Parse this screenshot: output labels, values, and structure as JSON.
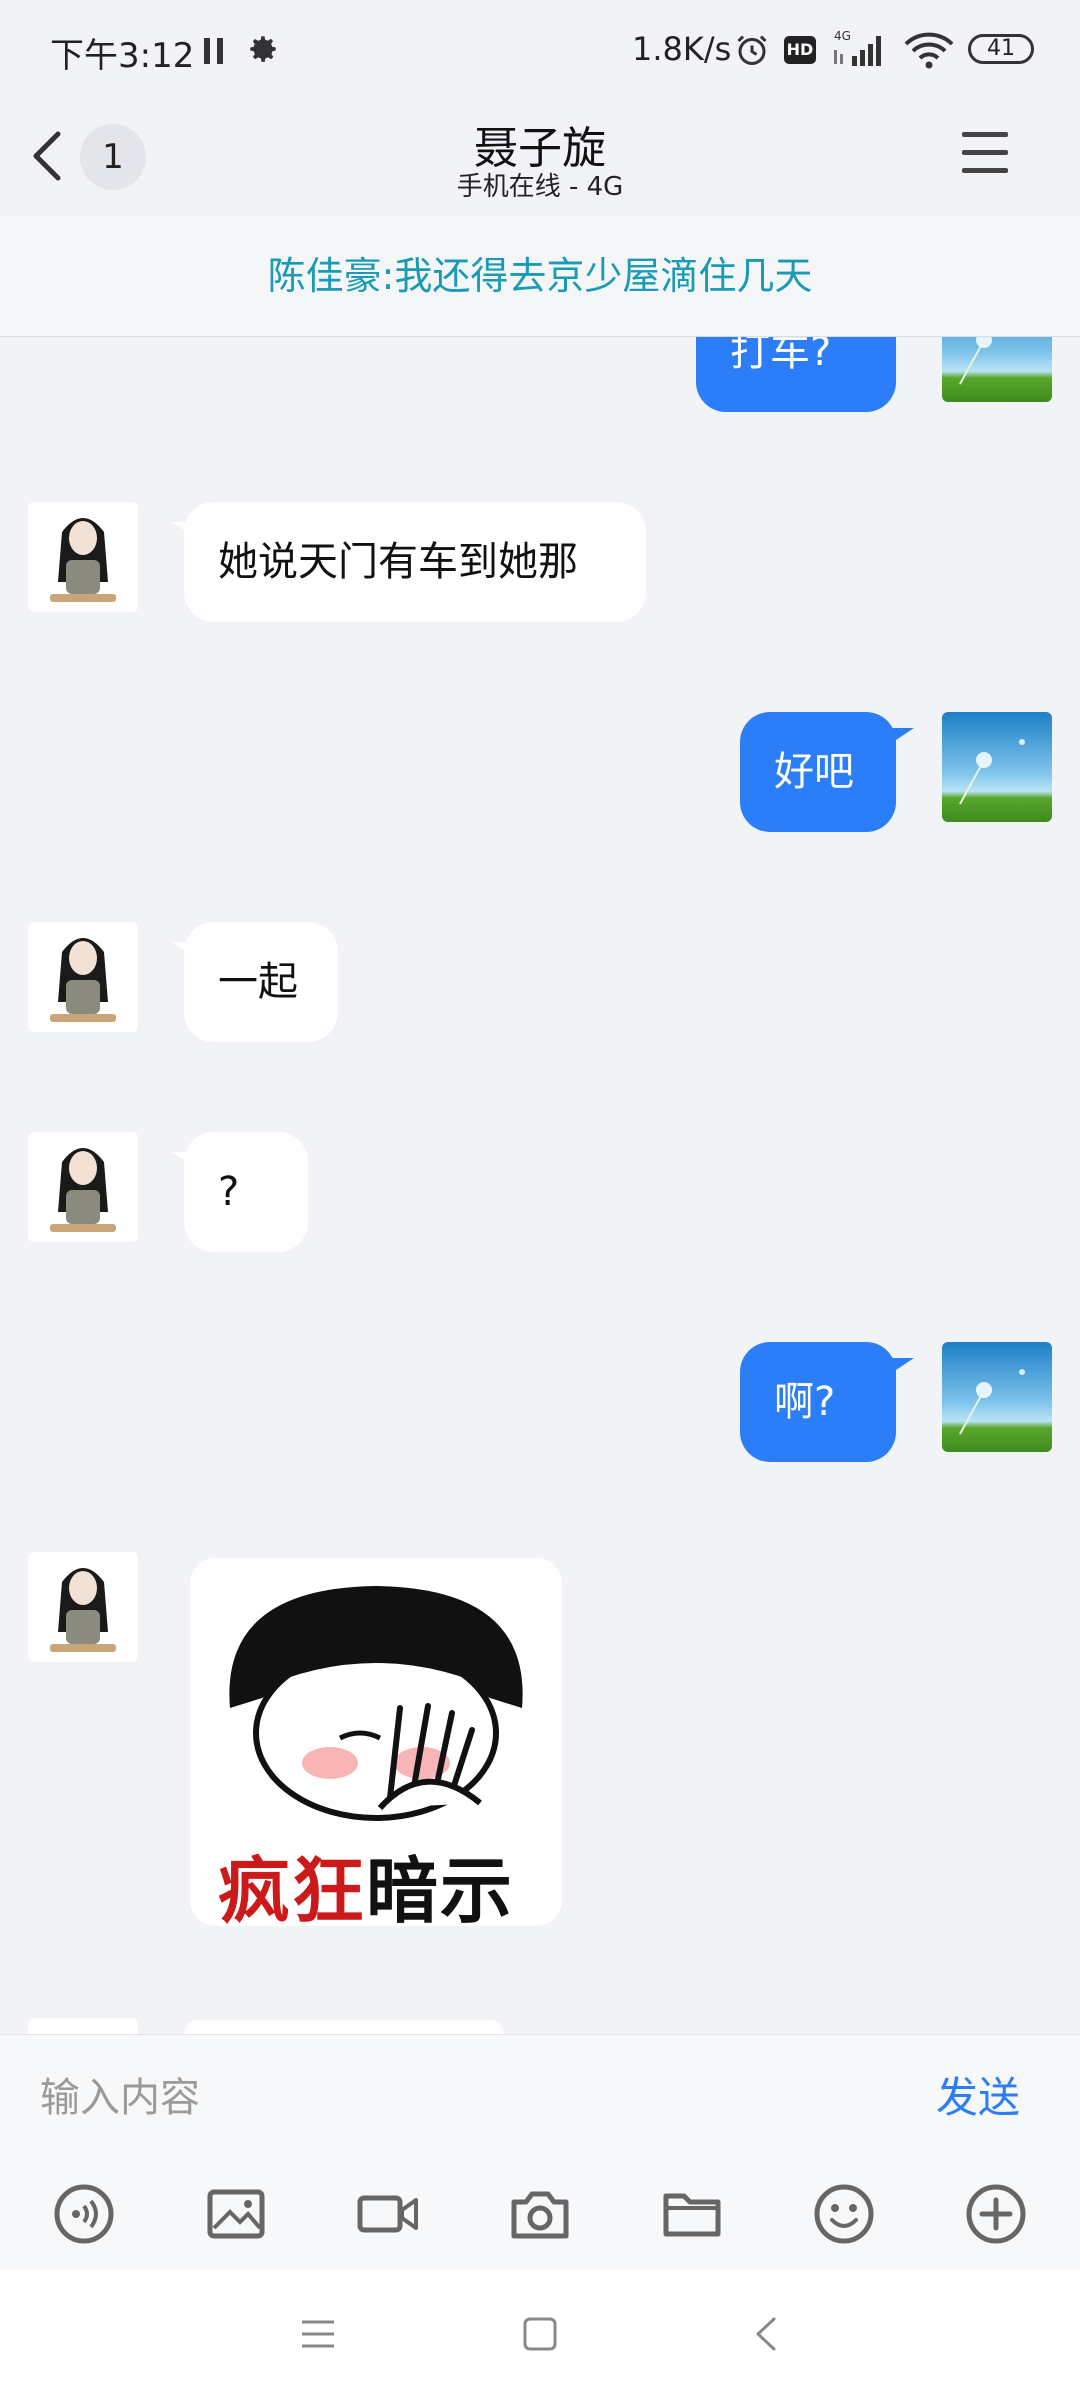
{
  "status_bar": {
    "time": "下午3:12",
    "net_speed": "1.8K/s",
    "hd_label": "HD",
    "network_label": "4G",
    "battery": "41",
    "icons": [
      "pause-icon",
      "gear-icon",
      "alarm-icon",
      "signal-icon",
      "wifi-icon",
      "battery-icon"
    ]
  },
  "header": {
    "unread_count": "1",
    "title": "聂子旋",
    "subtitle": "手机在线 - 4G"
  },
  "pinned_message": "陈佳豪:我还得去京少屋滴住几天",
  "messages": [
    {
      "side": "right",
      "text": "打车?"
    },
    {
      "side": "left",
      "text": "她说天门有车到她那"
    },
    {
      "side": "right",
      "text": "好吧"
    },
    {
      "side": "left",
      "text": "一起"
    },
    {
      "side": "left",
      "text": "?"
    },
    {
      "side": "right",
      "text": "啊?"
    },
    {
      "side": "left",
      "type": "sticker",
      "sticker_text_red": "疯狂",
      "sticker_text_black": "暗示"
    }
  ],
  "input": {
    "placeholder": "输入内容",
    "send_label": "发送"
  },
  "toolbar": [
    "voice-icon",
    "image-icon",
    "video-icon",
    "camera-icon",
    "folder-icon",
    "emoji-icon",
    "plus-icon"
  ],
  "colors": {
    "accent": "#2b7ef7",
    "pinned_text": "#199ab5",
    "background": "#f2f3f7"
  }
}
